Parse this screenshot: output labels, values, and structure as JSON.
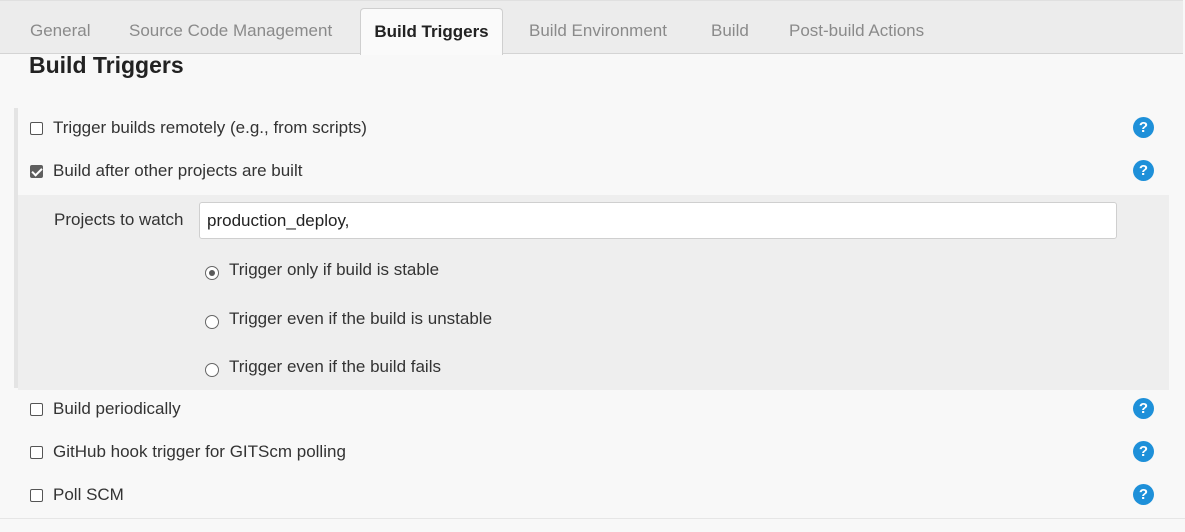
{
  "tabs": [
    {
      "label": "General",
      "active": false
    },
    {
      "label": "Source Code Management",
      "active": false
    },
    {
      "label": "Build Triggers",
      "active": true
    },
    {
      "label": "Build Environment",
      "active": false
    },
    {
      "label": "Build",
      "active": false
    },
    {
      "label": "Post-build Actions",
      "active": false
    }
  ],
  "section_title": "Build Triggers",
  "triggers": [
    {
      "label": "Trigger builds remotely (e.g., from scripts)",
      "checked": false
    },
    {
      "label": "Build after other projects are built",
      "checked": true
    },
    {
      "label": "Build periodically",
      "checked": false
    },
    {
      "label": "GitHub hook trigger for GITScm polling",
      "checked": false
    },
    {
      "label": "Poll SCM",
      "checked": false
    }
  ],
  "help_icon": "?",
  "projects_to_watch": {
    "label": "Projects to watch",
    "value": "production_deploy,"
  },
  "trigger_conditions": [
    {
      "label": "Trigger only if build is stable",
      "selected": true
    },
    {
      "label": "Trigger even if the build is unstable",
      "selected": false
    },
    {
      "label": "Trigger even if the build fails",
      "selected": false
    }
  ],
  "colors": {
    "help_blue": "#1e90d9",
    "tabbar_bg": "#ececec"
  }
}
